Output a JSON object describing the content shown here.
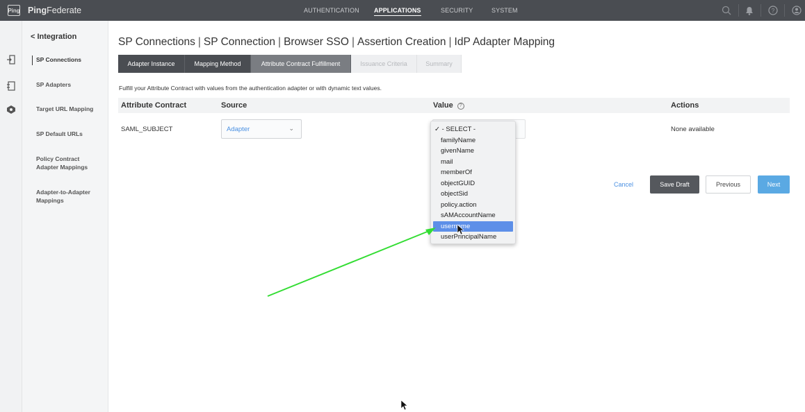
{
  "app": {
    "logo_text": "Ping",
    "brand_bold": "Ping",
    "brand_rest": "Federate"
  },
  "topnav": [
    {
      "label": "AUTHENTICATION",
      "active": false
    },
    {
      "label": "APPLICATIONS",
      "active": true
    },
    {
      "label": "SECURITY",
      "active": false
    },
    {
      "label": "SYSTEM",
      "active": false
    }
  ],
  "sidebar": {
    "back_label": "< Integration",
    "items": [
      {
        "label": "SP Connections",
        "active": true
      },
      {
        "label": "SP Adapters"
      },
      {
        "label": "Target URL Mapping"
      },
      {
        "label": "SP Default URLs"
      },
      {
        "label": "Policy Contract Adapter Mappings"
      },
      {
        "label": "Adapter-to-Adapter Mappings"
      }
    ]
  },
  "breadcrumb": [
    "SP Connections",
    "SP Connection",
    "Browser SSO",
    "Assertion Creation",
    "IdP Adapter Mapping"
  ],
  "tabs": [
    "Adapter Instance",
    "Mapping Method",
    "Attribute Contract Fulfillment",
    "Issuance Criteria",
    "Summary"
  ],
  "description": "Fulfill your Attribute Contract with values from the authentication adapter or with dynamic text values.",
  "table": {
    "headers": {
      "contract": "Attribute Contract",
      "source": "Source",
      "value": "Value",
      "actions": "Actions"
    },
    "row": {
      "contract": "SAML_SUBJECT",
      "source": "Adapter",
      "actions": "None available"
    }
  },
  "dropdown": {
    "selected": "- SELECT -",
    "highlighted": "username",
    "options": [
      "- SELECT -",
      "familyName",
      "givenName",
      "mail",
      "memberOf",
      "objectGUID",
      "objectSid",
      "policy.action",
      "sAMAccountName",
      "username",
      "userPrincipalName"
    ]
  },
  "buttons": {
    "cancel": "Cancel",
    "save_draft": "Save Draft",
    "previous": "Previous",
    "next": "Next"
  },
  "colors": {
    "topbar": "#4a4d52",
    "highlight": "#5d8fe8",
    "next_button": "#5aa9e3",
    "link": "#4a90e2",
    "annotation_arrow": "#33dd33"
  }
}
